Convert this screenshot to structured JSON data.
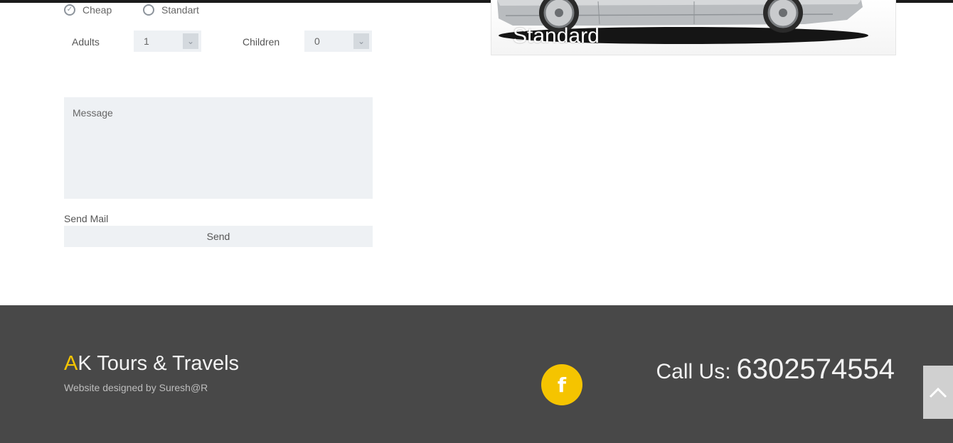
{
  "form": {
    "class_options": [
      {
        "label": "Cheap",
        "selected": true
      },
      {
        "label": "Standart",
        "selected": false
      }
    ],
    "adults": {
      "label": "Adults",
      "value": "1"
    },
    "children": {
      "label": "Children",
      "value": "0"
    },
    "message": {
      "placeholder": "Message",
      "value": ""
    },
    "send_label": "Send Mail",
    "send_button": "Send"
  },
  "car_card": {
    "title": "Standard"
  },
  "footer": {
    "brand_initial": "A",
    "brand_rest": "K Tours & Travels",
    "credit": "Website designed by Suresh@R",
    "call_label": "Call Us:",
    "phone": "6302574554",
    "facebook_icon": "f"
  },
  "colors": {
    "accent": "#f5c400",
    "footer_bg": "#484848",
    "field_bg": "#eef1f4"
  },
  "icons": {
    "facebook": "facebook-icon",
    "back_to_top": "chevron-up-icon",
    "select_arrow": "chevron-down-icon"
  }
}
